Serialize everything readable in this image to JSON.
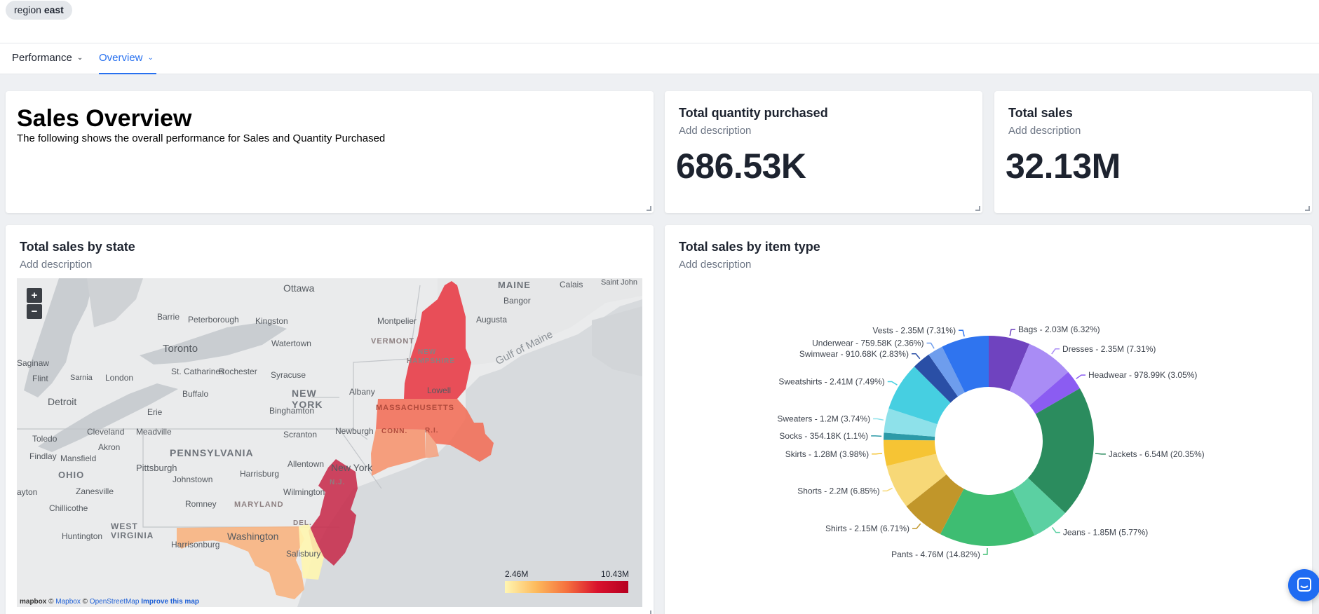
{
  "filter": {
    "label": "region",
    "value": "east"
  },
  "tabs": [
    {
      "label": "Performance",
      "active": false
    },
    {
      "label": "Overview",
      "active": true
    }
  ],
  "overview": {
    "title": "Sales Overview",
    "subtitle": "The following shows the overall performance for Sales and Quantity Purchased"
  },
  "kpis": [
    {
      "title": "Total quantity purchased",
      "description": "Add description",
      "value": "686.53K"
    },
    {
      "title": "Total sales",
      "description": "Add description",
      "value": "32.13M"
    }
  ],
  "map_card": {
    "title": "Total sales by state",
    "description": "Add description",
    "zoom_in": "+",
    "zoom_out": "−",
    "legend": {
      "min": "2.46M",
      "max": "10.43M"
    },
    "attribution": {
      "logo": "mapbox",
      "copy1": "©",
      "mapbox": "Mapbox",
      "copy2": "©",
      "osm": "OpenStreetMap",
      "improve": "Improve this map"
    },
    "place_labels": [
      "MAINE",
      "Calais",
      "Saint John",
      "Ottawa",
      "Bangor",
      "Barrie",
      "Peterborough",
      "Kingston",
      "Montpelier",
      "Augusta",
      "VERMONT",
      "NEW",
      "HAMPSHIRE",
      "Toronto",
      "Watertown",
      "Saginaw",
      "St. Catharines",
      "Rochester",
      "Flint",
      "Sarnia",
      "London",
      "Syracuse",
      "NEW",
      "YORK",
      "Albany",
      "Lowell",
      "Gulf of Maine",
      "Detroit",
      "Buffalo",
      "MASSACHUSETTS",
      "Erie",
      "Binghamton",
      "Cleveland",
      "Meadville",
      "Newburgh",
      "CONN.",
      "R.I.",
      "Toledo",
      "Akron",
      "PENNSYLVANIA",
      "Scranton",
      "Findlay",
      "Mansfield",
      "Pittsburgh",
      "Allentown",
      "New York",
      "OHIO",
      "Johnstown",
      "Harrisburg",
      "N.J.",
      "Zanesville",
      "Wilmington",
      "ayton",
      "Chillicothe",
      "Romney",
      "MARYLAND",
      "DEL.",
      "WEST",
      "VIRGINIA",
      "Huntington",
      "Washington",
      "Harrisonburg",
      "Salisbury"
    ],
    "colors": {
      "nh": "#e8323e",
      "ma": "#f36a52",
      "ct": "#f7906a",
      "ri": "#f5a07c",
      "nj": "#c72647",
      "md": "#f9b07a",
      "de": "#fff6b0"
    }
  },
  "chart_data": {
    "type": "pie",
    "title": "Total sales by item type",
    "description": "Add description",
    "donut": true,
    "slices": [
      {
        "name": "Bags",
        "value": 2.03,
        "label": "Bags - 2.03M (6.32%)",
        "color": "#6f43bf"
      },
      {
        "name": "Dresses",
        "value": 2.35,
        "label": "Dresses - 2.35M (7.31%)",
        "color": "#a98cf5"
      },
      {
        "name": "Headwear",
        "value": 0.97899,
        "label": "Headwear - 978.99K (3.05%)",
        "color": "#8b5cf2"
      },
      {
        "name": "Jackets",
        "value": 6.54,
        "label": "Jackets - 6.54M (20.35%)",
        "color": "#2b8c5e"
      },
      {
        "name": "Jeans",
        "value": 1.85,
        "label": "Jeans - 1.85M (5.77%)",
        "color": "#5bd0a2"
      },
      {
        "name": "Pants",
        "value": 4.76,
        "label": "Pants - 4.76M (14.82%)",
        "color": "#3ebd72"
      },
      {
        "name": "Shirts",
        "value": 2.15,
        "label": "Shirts - 2.15M (6.71%)",
        "color": "#c1962a"
      },
      {
        "name": "Shorts",
        "value": 2.2,
        "label": "Shorts - 2.2M (6.85%)",
        "color": "#f7d877"
      },
      {
        "name": "Skirts",
        "value": 1.28,
        "label": "Skirts - 1.28M (3.98%)",
        "color": "#f6c434"
      },
      {
        "name": "Socks",
        "value": 0.35418,
        "label": "Socks - 354.18K (1.1%)",
        "color": "#2c9aa8"
      },
      {
        "name": "Sweaters",
        "value": 1.2,
        "label": "Sweaters - 1.2M (3.74%)",
        "color": "#8ee1ea"
      },
      {
        "name": "Sweatshirts",
        "value": 2.41,
        "label": "Sweatshirts - 2.41M (7.49%)",
        "color": "#46cfe1"
      },
      {
        "name": "Swimwear",
        "value": 0.91068,
        "label": "Swimwear - 910.68K (2.83%)",
        "color": "#2a4fa6"
      },
      {
        "name": "Underwear",
        "value": 0.75958,
        "label": "Underwear - 759.58K (2.36%)",
        "color": "#6e9ded"
      },
      {
        "name": "Vests",
        "value": 2.35,
        "label": "Vests - 2.35M (7.31%)",
        "color": "#2f74ef"
      }
    ]
  }
}
